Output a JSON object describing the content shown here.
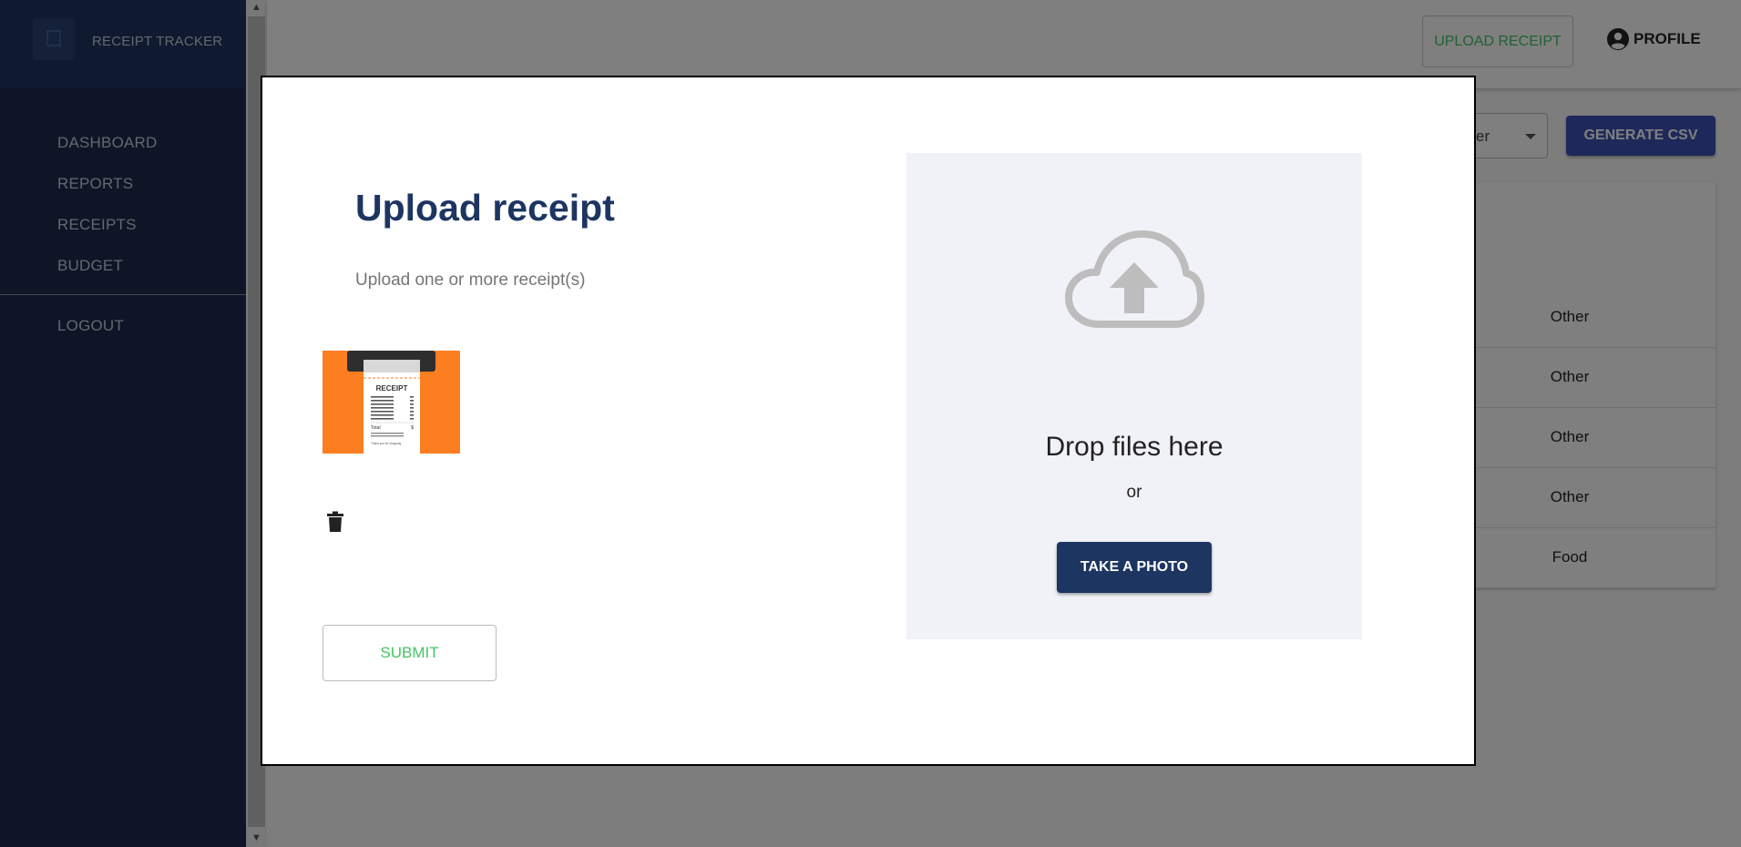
{
  "app": {
    "title": "RECEIPT TRACKER"
  },
  "sidebar": {
    "items": [
      {
        "label": "DASHBOARD"
      },
      {
        "label": "REPORTS"
      },
      {
        "label": "RECEIPTS"
      },
      {
        "label": "BUDGET"
      }
    ],
    "logout_label": "LOGOUT"
  },
  "header": {
    "upload_label": "UPLOAD RECEIPT",
    "profile_label": "PROFILE"
  },
  "toolbar": {
    "select_partial_text": "er",
    "csv_label": "GENERATE CSV"
  },
  "table": {
    "category_values": [
      "Other",
      "Other",
      "Other",
      "Other",
      "Food"
    ]
  },
  "modal": {
    "title": "Upload receipt",
    "subtitle": "Upload one or more receipt(s)",
    "thumbnail": {
      "receipt_heading": "RECEIPT",
      "total_label": "Total",
      "total_symbol": "$",
      "footer_text": "Thank you for shopping"
    },
    "submit_label": "SUBMIT",
    "dropzone": {
      "drop_text": "Drop files here",
      "or_text": "or",
      "photo_label": "TAKE A PHOTO"
    }
  },
  "colors": {
    "sidebar": "#1a2b4e",
    "title": "#1d3561",
    "accent_green": "#43c463",
    "csv_button": "#3f51b5",
    "thumbnail_bg": "#fb7f21"
  },
  "icons": {
    "logo": "receipt-icon",
    "profile": "account-circle-icon",
    "delete": "trash-icon",
    "upload": "cloud-upload-icon"
  }
}
